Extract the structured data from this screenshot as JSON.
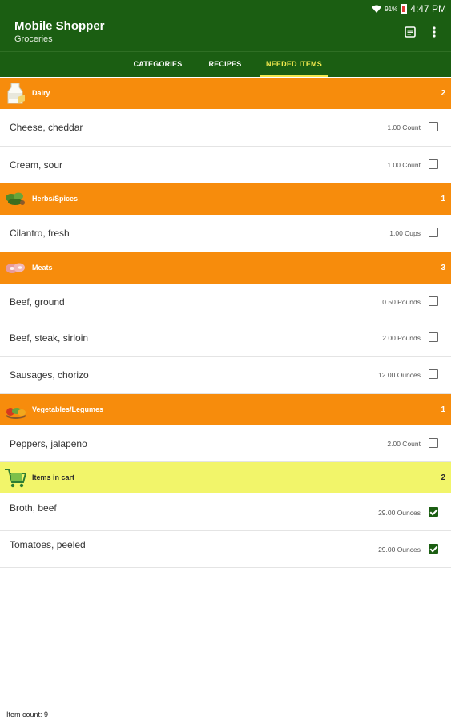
{
  "status_bar": {
    "battery": "91%",
    "time": "4:47 PM"
  },
  "app": {
    "title": "Mobile Shopper",
    "subtitle": "Groceries"
  },
  "actions": {
    "list_icon": "list-view-icon",
    "overflow_icon": "more-vert-icon"
  },
  "tabs": [
    {
      "label": "CATEGORIES",
      "active": false
    },
    {
      "label": "RECIPES",
      "active": false
    },
    {
      "label": "NEEDED ITEMS",
      "active": true
    }
  ],
  "sections": [
    {
      "name": "Dairy",
      "count": "2",
      "icon": "dairy-icon",
      "items": [
        {
          "name": "Cheese, cheddar",
          "qty": "1.00 Count",
          "checked": false
        },
        {
          "name": "Cream, sour",
          "qty": "1.00 Count",
          "checked": false
        }
      ]
    },
    {
      "name": "Herbs/Spices",
      "count": "1",
      "icon": "herbs-icon",
      "items": [
        {
          "name": "Cilantro, fresh",
          "qty": "1.00 Cups",
          "checked": false
        }
      ]
    },
    {
      "name": "Meats",
      "count": "3",
      "icon": "meat-icon",
      "items": [
        {
          "name": "Beef, ground",
          "qty": "0.50 Pounds",
          "checked": false
        },
        {
          "name": "Beef, steak, sirloin",
          "qty": "2.00 Pounds",
          "checked": false
        },
        {
          "name": "Sausages, chorizo",
          "qty": "12.00 Ounces",
          "checked": false
        }
      ]
    },
    {
      "name": "Vegetables/Legumes",
      "count": "1",
      "icon": "vegetables-icon",
      "items": [
        {
          "name": "Peppers, jalapeno",
          "qty": "2.00 Count",
          "checked": false
        }
      ]
    },
    {
      "name": "Items in cart",
      "count": "2",
      "icon": "cart-icon",
      "cart": true,
      "items": [
        {
          "name": "Broth, beef",
          "qty": "29.00 Ounces",
          "checked": true
        },
        {
          "name": "Tomatoes, peeled",
          "qty": "29.00 Ounces",
          "checked": true
        }
      ]
    }
  ],
  "footer": {
    "item_count": "Item count: 9"
  },
  "colors": {
    "app_bar": "#1b5e12",
    "category_header": "#f78c0c",
    "cart_header": "#f2f56a",
    "active_tab": "#f2e94e"
  }
}
